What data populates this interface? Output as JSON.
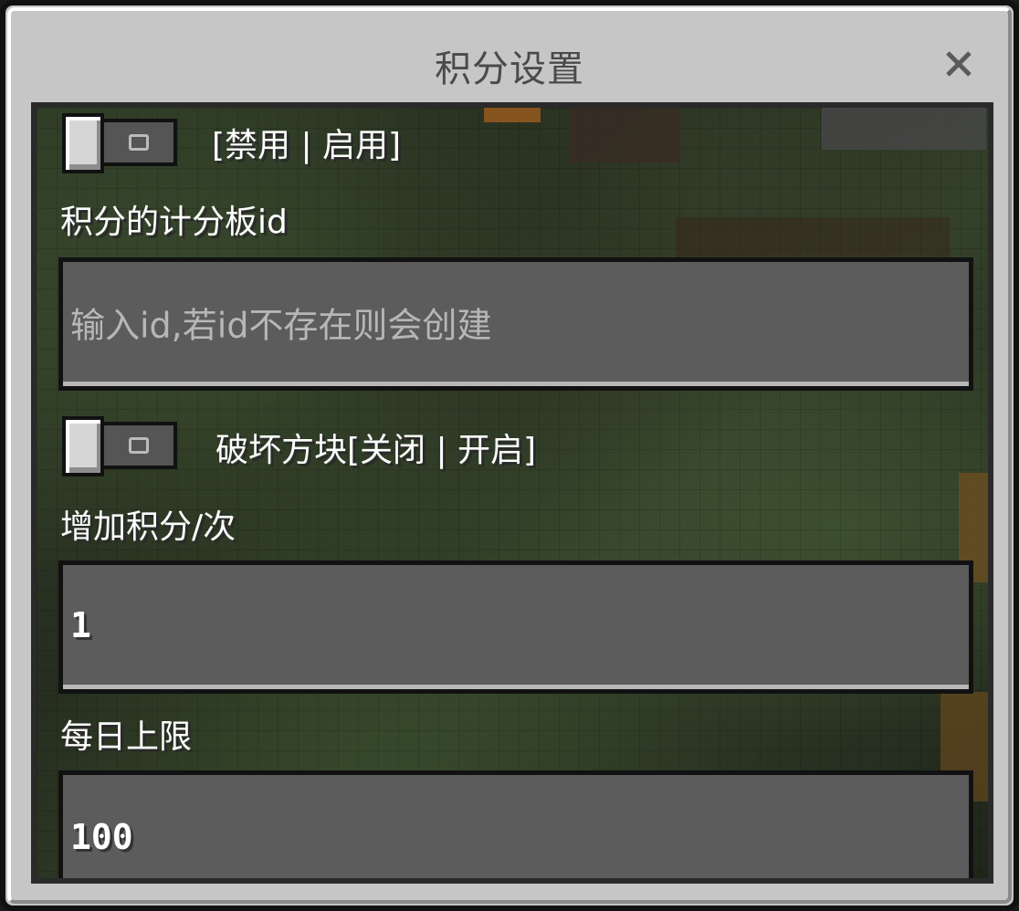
{
  "dialog": {
    "title": "积分设置",
    "close_icon": "close-icon"
  },
  "settings": {
    "enable_toggle": {
      "label": "[禁用 | 启用]",
      "state": "off"
    },
    "scoreboard_id": {
      "label": "积分的计分板id",
      "placeholder": "输入id,若id不存在则会创建",
      "value": ""
    },
    "break_block_toggle": {
      "label": "破坏方块[关闭 | 开启]",
      "state": "off"
    },
    "points_per_time": {
      "label": "增加积分/次",
      "value": "1"
    },
    "daily_limit": {
      "label": "每日上限",
      "value": "100"
    }
  },
  "colors": {
    "dialog_bg": "#c6c6c6",
    "field_bg": "#5c5c5c",
    "title_text": "#4a4a4a",
    "label_text": "#ffffff"
  }
}
